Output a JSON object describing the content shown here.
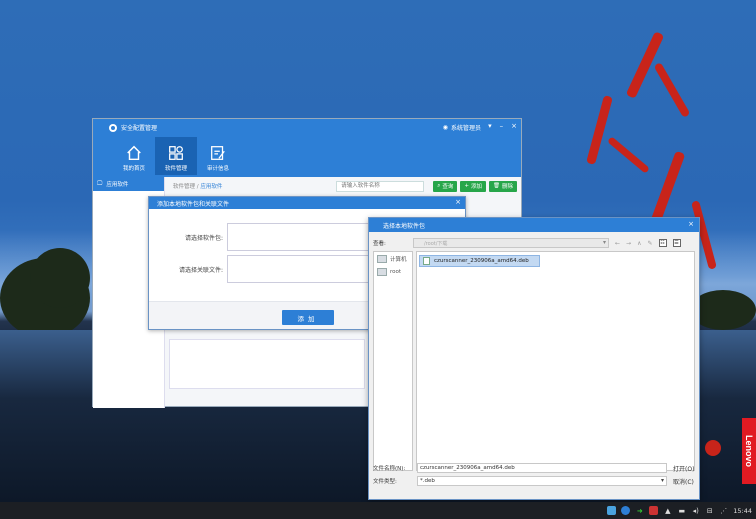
{
  "app": {
    "title": "安全配置管理",
    "user": "系统管理员",
    "window_controls": [
      "▾",
      "–",
      "×"
    ],
    "nav": [
      {
        "label": "我的首页"
      },
      {
        "label": "软件管理"
      },
      {
        "label": "审计信息"
      }
    ],
    "sidebar_item": "应用软件",
    "breadcrumb": {
      "parent": "软件管理 /",
      "current": "应用软件"
    },
    "search_placeholder": "请输入软件名称",
    "buttons": {
      "query": "查询",
      "add": "添加",
      "delete": "删除"
    }
  },
  "add_dialog": {
    "title": "添加本地软件包和关联文件",
    "close": "×",
    "package_label": "请选择软件包:",
    "related_label": "请选择关联文件:",
    "submit": "添加"
  },
  "file_chooser": {
    "title": "选择本地软件包",
    "close": "×",
    "look_in_label": "查看:",
    "look_in_value": "/root/下载",
    "nav_icons": [
      "back-icon",
      "forward-icon",
      "up-icon",
      "new-folder-icon",
      "list-view-icon",
      "detail-view-icon"
    ],
    "places": [
      {
        "label": "计算机"
      },
      {
        "label": "root"
      }
    ],
    "files": [
      {
        "name": "czurscanner_230906a_amd64.deb"
      }
    ],
    "filename_label": "文件名称(N):",
    "filename_value": "czurscanner_230906a_amd64.deb",
    "filetype_label": "文件类型:",
    "filetype_value": "*.deb",
    "open_label": "打开(O)",
    "cancel_label": "取消(C)"
  },
  "desktop": {
    "brand": "Lenovo",
    "clock": "15:44"
  },
  "colors": {
    "accent": "#2d7fd6",
    "green": "#27a64a",
    "lenovo_red": "#e11a22"
  }
}
